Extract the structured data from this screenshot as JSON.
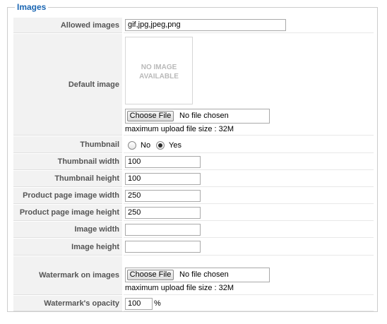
{
  "section": {
    "legend": "Images"
  },
  "fields": {
    "allowed_images": {
      "label": "Allowed images",
      "value": "gif,jpg,jpeg,png"
    },
    "default_image": {
      "label": "Default image",
      "placeholder_line1": "NO IMAGE",
      "placeholder_line2": "AVAILABLE",
      "button": "Choose File",
      "file_status": "No file chosen",
      "note": "maximum upload file size : 32M"
    },
    "thumbnail": {
      "label": "Thumbnail",
      "option_no": "No",
      "option_yes": "Yes",
      "selected": "Yes"
    },
    "thumbnail_width": {
      "label": "Thumbnail width",
      "value": "100"
    },
    "thumbnail_height": {
      "label": "Thumbnail height",
      "value": "100"
    },
    "product_image_width": {
      "label": "Product page image width",
      "value": "250"
    },
    "product_image_height": {
      "label": "Product page image height",
      "value": "250"
    },
    "image_width": {
      "label": "Image width",
      "value": ""
    },
    "image_height": {
      "label": "Image height",
      "value": ""
    },
    "watermark": {
      "label": "Watermark on images",
      "button": "Choose File",
      "file_status": "No file chosen",
      "note": "maximum upload file size : 32M"
    },
    "watermark_opacity": {
      "label": "Watermark's opacity",
      "value": "100",
      "unit": "%"
    }
  }
}
